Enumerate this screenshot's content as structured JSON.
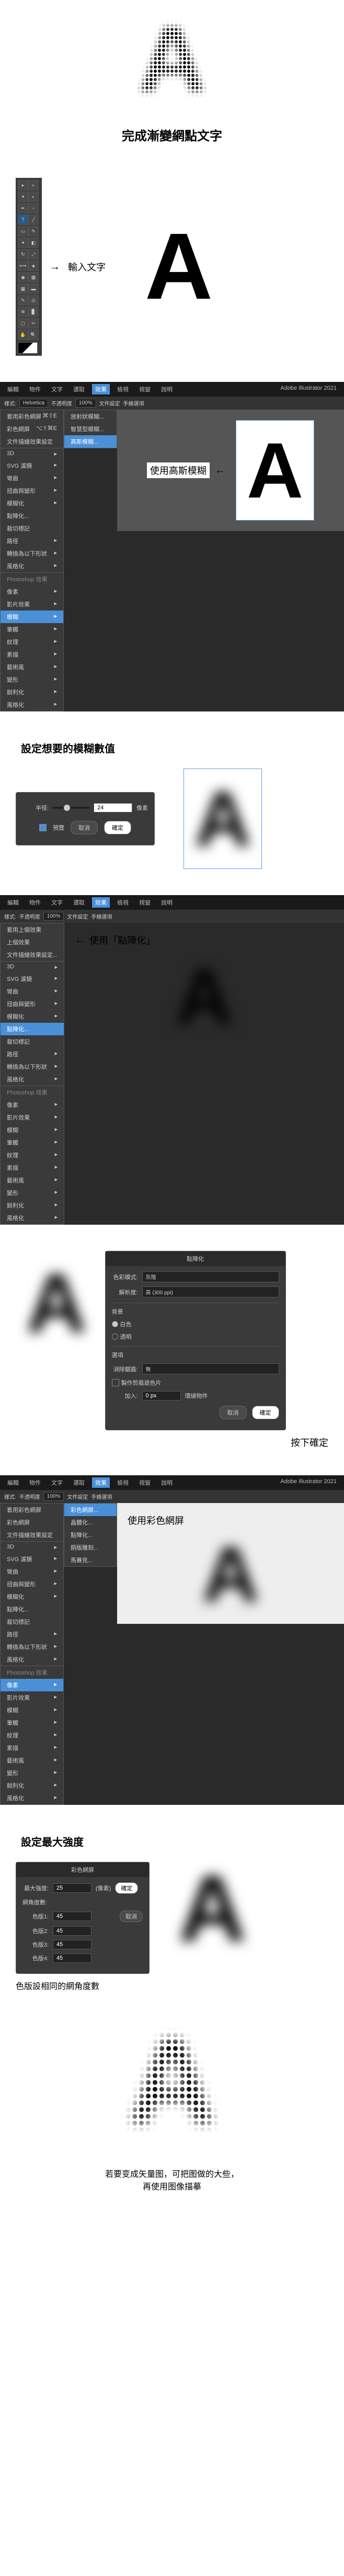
{
  "hero": {
    "letter": "A",
    "title": "完成漸變網點文字"
  },
  "step1": {
    "arrow": "→",
    "label": "輸入文字",
    "letter": "A"
  },
  "app": {
    "menus": [
      "編輯",
      "物件",
      "文字",
      "選取",
      "效果",
      "檢視",
      "視窗",
      "說明"
    ],
    "title": "Adobe Illustrator 2021",
    "toolbar": {
      "item1": "套用彩色網屏",
      "shortcut1": "⌘⇧E",
      "item2": "彩色網屏",
      "shortcut2": "⌥⇧⌘E",
      "item3": "文件描繪效果設定",
      "font": "Helvetica",
      "pct": "100%"
    }
  },
  "blur_menu": {
    "items": [
      "3D",
      "SVG 濾鏡",
      "彎曲",
      "扭曲與變形",
      "模糊化",
      "點陣化...",
      "裁切標記",
      "路徑",
      "轉換為以下形狀",
      "風格化",
      "Photoshop 效果"
    ],
    "sub_items": [
      "像素",
      "影片效果",
      "模糊",
      "筆觸",
      "紋理",
      "素描",
      "藝術風",
      "變形",
      "銳利化",
      "風格化"
    ],
    "blur_opts": [
      "放射狀模糊...",
      "智慧型模糊...",
      "高斯模糊..."
    ],
    "label": "使用高斯模糊",
    "arrow": "←"
  },
  "blur_dialog": {
    "title": "設定想要的模糊數值",
    "field_label": "半徑:",
    "value": "24",
    "unit": "像素",
    "preview": "預覽",
    "cancel": "取消",
    "ok": "確定"
  },
  "raster_menu": {
    "items": [
      "套用上個效果",
      "上個效果",
      "文件描繪效果設定...",
      "3D",
      "SVG 濾鏡",
      "彎曲",
      "扭曲與變形",
      "模糊化",
      "點陣化...",
      "裁切標記",
      "路徑",
      "轉換為以下形狀",
      "風格化",
      "Photoshop 效果",
      "像素",
      "影片效果",
      "模糊",
      "筆觸",
      "紋理",
      "素描",
      "藝術風",
      "變形",
      "銳利化",
      "風格化"
    ],
    "label": "使用「點陣化」",
    "arrow": "←"
  },
  "raster_dialog": {
    "header": "點陣化",
    "fields": {
      "colormode_label": "色彩模式:",
      "colormode_value": "灰階",
      "res_label": "解析度:",
      "res_value": "高 (300 ppi)",
      "bg_label": "背景",
      "bg_white": "白色",
      "bg_trans": "透明",
      "opts_label": "選項",
      "aa_label": "消除鋸齒:",
      "aa_value": "無",
      "mask": "製作剪裁遮色片",
      "add_label": "加入:",
      "add_value": "0 px",
      "add_suffix": "環繞物件"
    },
    "cancel": "取消",
    "ok": "確定",
    "confirm_label": "按下確定"
  },
  "halftone_menu": {
    "top": [
      "套用彩色網屏",
      "彩色網屏",
      "文件描繪效果設定"
    ],
    "items": [
      "3D",
      "SVG 濾鏡",
      "彎曲",
      "扭曲與變形",
      "模糊化",
      "點陣化...",
      "裁切標記",
      "路徑",
      "轉換為以下形狀",
      "風格化",
      "Photoshop 效果"
    ],
    "sub": [
      "像素",
      "影片效果",
      "模糊",
      "筆觸",
      "紋理",
      "素描",
      "藝術風",
      "變形",
      "銳利化",
      "風格化"
    ],
    "pixel_opts": [
      "彩色網屏...",
      "晶體化...",
      "點陣化...",
      "銅版雕刻...",
      "馬賽克..."
    ],
    "label": "使用彩色網屏"
  },
  "halftone_dialog": {
    "header": "彩色網屏",
    "title": "設定最大強度",
    "max_label": "最大強度:",
    "max_value": "25",
    "max_unit": "(像素)",
    "angle_label": "網角度數:",
    "ch1_label": "色版1:",
    "ch1": "45",
    "ch2_label": "色版2:",
    "ch2": "45",
    "ch3_label": "色版3:",
    "ch3": "45",
    "ch4_label": "色版4:",
    "ch4": "45",
    "cancel": "取消",
    "ok": "確定",
    "note": "色版設相同的網角度數"
  },
  "final": {
    "letter": "A",
    "note": "若要变成矢量图，可把图做的大些，\n再使用图像描摹"
  },
  "toolbar_options": {
    "style_label": "樣式:",
    "opacity": "不透明度",
    "live": "文件設定",
    "prefs": "手繪選項"
  }
}
